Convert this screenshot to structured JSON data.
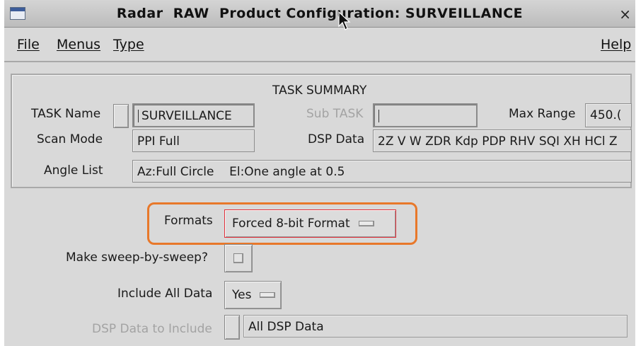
{
  "window": {
    "title": "Radar  RAW  Product Configuration: SURVEILLANCE",
    "close_glyph": "×"
  },
  "menubar": {
    "file": "File",
    "menus": "Menus",
    "type": "Type",
    "help": "Help"
  },
  "summary": {
    "heading": "TASK SUMMARY",
    "task_name_label": "TASK Name",
    "task_name_value": "SURVEILLANCE",
    "sub_task_label": "Sub TASK",
    "sub_task_value": "",
    "max_range_label": "Max Range",
    "max_range_value": "450.(",
    "scan_mode_label": "Scan Mode",
    "scan_mode_value": "PPI Full",
    "dsp_data_label": "DSP Data",
    "dsp_data_value": "2Z V W ZDR Kdp PDP RHV SQI XH HCl Z",
    "angle_list_label": "Angle List",
    "angle_list_value": "Az:Full Circle    El:One angle at 0.5"
  },
  "config": {
    "formats_label": "Formats",
    "formats_value": "Forced 8-bit Format",
    "sweep_label": "Make sweep-by-sweep?",
    "include_all_label": "Include All Data",
    "include_all_value": "Yes",
    "dsp_include_label": "DSP Data to Include",
    "dsp_include_value": "All DSP Data"
  },
  "colors": {
    "highlight": "#e8782a",
    "active_border": "#e0303a"
  }
}
